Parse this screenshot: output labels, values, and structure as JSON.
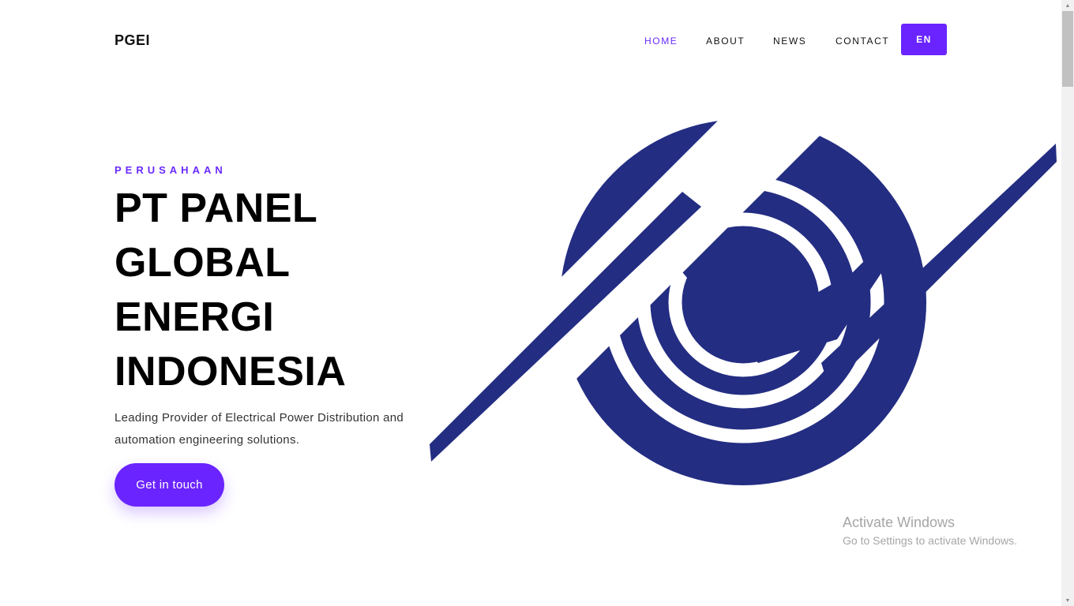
{
  "navbar": {
    "brand": "PGEI",
    "links": [
      {
        "label": "HOME",
        "active": true
      },
      {
        "label": "ABOUT",
        "active": false
      },
      {
        "label": "NEWS",
        "active": false
      },
      {
        "label": "CONTACT",
        "active": false
      }
    ],
    "language_button": "EN"
  },
  "hero": {
    "eyebrow": "PERUSAHAAN",
    "title_lines": [
      "PT PANEL",
      "GLOBAL",
      "ENERGI",
      "INDONESIA"
    ],
    "description": "Leading Provider of Electrical Power Distribution and automation engineering solutions.",
    "cta_label": "Get in touch"
  },
  "watermark": {
    "title": "Activate Windows",
    "subtitle": "Go to Settings to activate Windows."
  },
  "colors": {
    "accent": "#6a24ff",
    "logo_blue": "#232d82",
    "text": "#111111"
  },
  "icons": {
    "scroll_up": "triangle-up",
    "scroll_down": "triangle-down"
  }
}
